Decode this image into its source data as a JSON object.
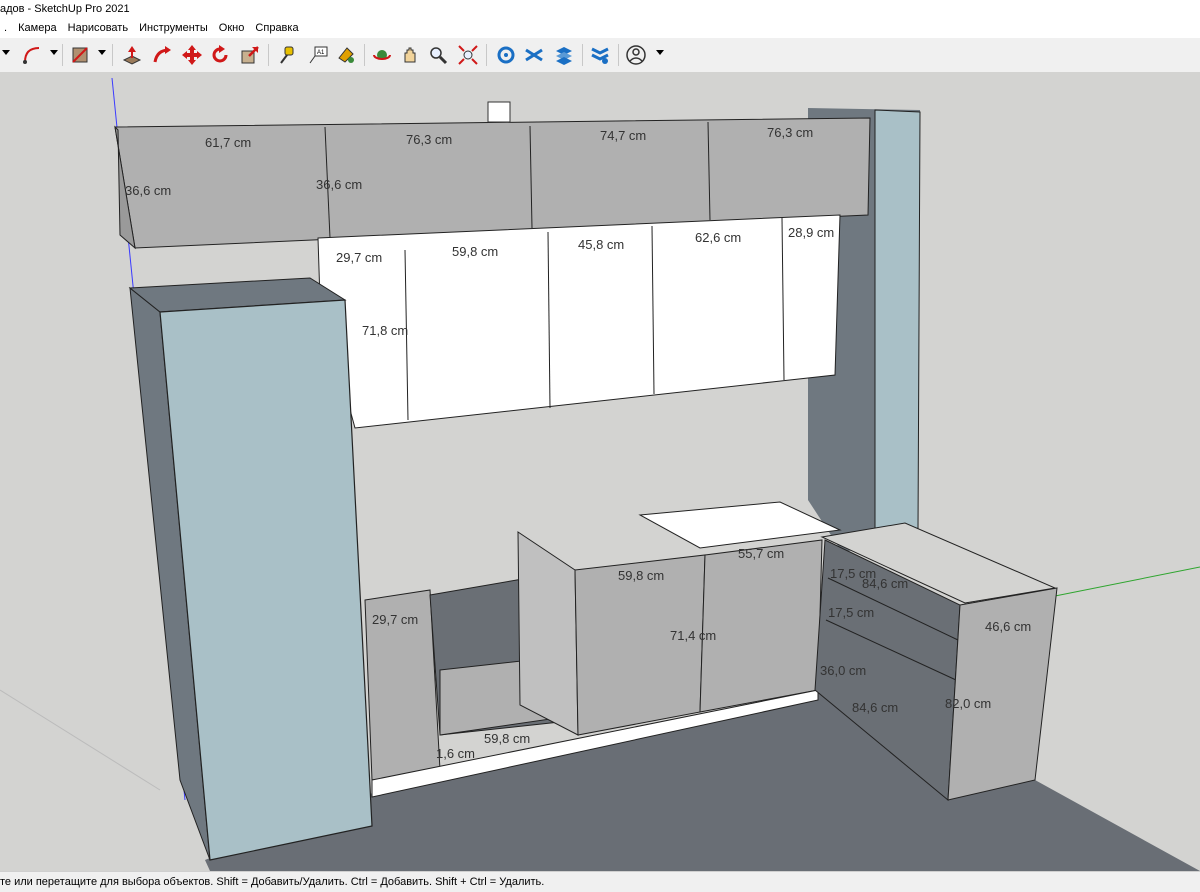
{
  "window": {
    "title": "адов - SketchUp Pro 2021"
  },
  "menu": [
    ".",
    "Камера",
    "Нарисовать",
    "Инструменты",
    "Окно",
    "Справка"
  ],
  "toolbar": {
    "icons": [
      "select-arrow",
      "arc-tool",
      "paint-bucket",
      "push-pull",
      "follow-me",
      "move",
      "rotate",
      "scale",
      "tape-measure",
      "text-label",
      "paint",
      "orbit",
      "pan",
      "zoom",
      "zoom-extents",
      "components",
      "section",
      "layers",
      "styles",
      "profile"
    ]
  },
  "model": {
    "upper_row": [
      "61,7 cm",
      "76,3 cm",
      "74,7 cm",
      "76,3 cm"
    ],
    "upper_height_left": "36,6 cm",
    "upper_height_mid": "36,6 cm",
    "wall_row": [
      "29,7 cm",
      "59,8 cm",
      "45,8 cm",
      "62,6 cm",
      "28,9 cm"
    ],
    "wall_height": "71,8 cm",
    "base_widths": [
      "29,7 cm",
      "59,8 cm",
      "55,7 cm"
    ],
    "base_height": "71,4 cm",
    "base_bottom": [
      "59,8 cm",
      "1,6 cm"
    ],
    "corner": {
      "drawer_top_1": "17,5 cm",
      "drawer_depth_1": "84,6 cm",
      "drawer_top_2": "17,5 cm",
      "drawer_height": "36,0 cm",
      "depth_bottom": "84,6 cm",
      "side_width": "46,6 cm",
      "side_height": "82,0 cm"
    }
  },
  "status": {
    "hint": "те или перетащите для выбора объектов. Shift = Добавить/Удалить. Ctrl = Добавить. Shift + Ctrl = Удалить."
  },
  "colors": {
    "background": "#d3d3d1",
    "floor": "#6a6f75",
    "cabinet_blue": "#a9c0c7",
    "panel_grey": "#b0b0b0",
    "white_front": "#ffffff"
  }
}
